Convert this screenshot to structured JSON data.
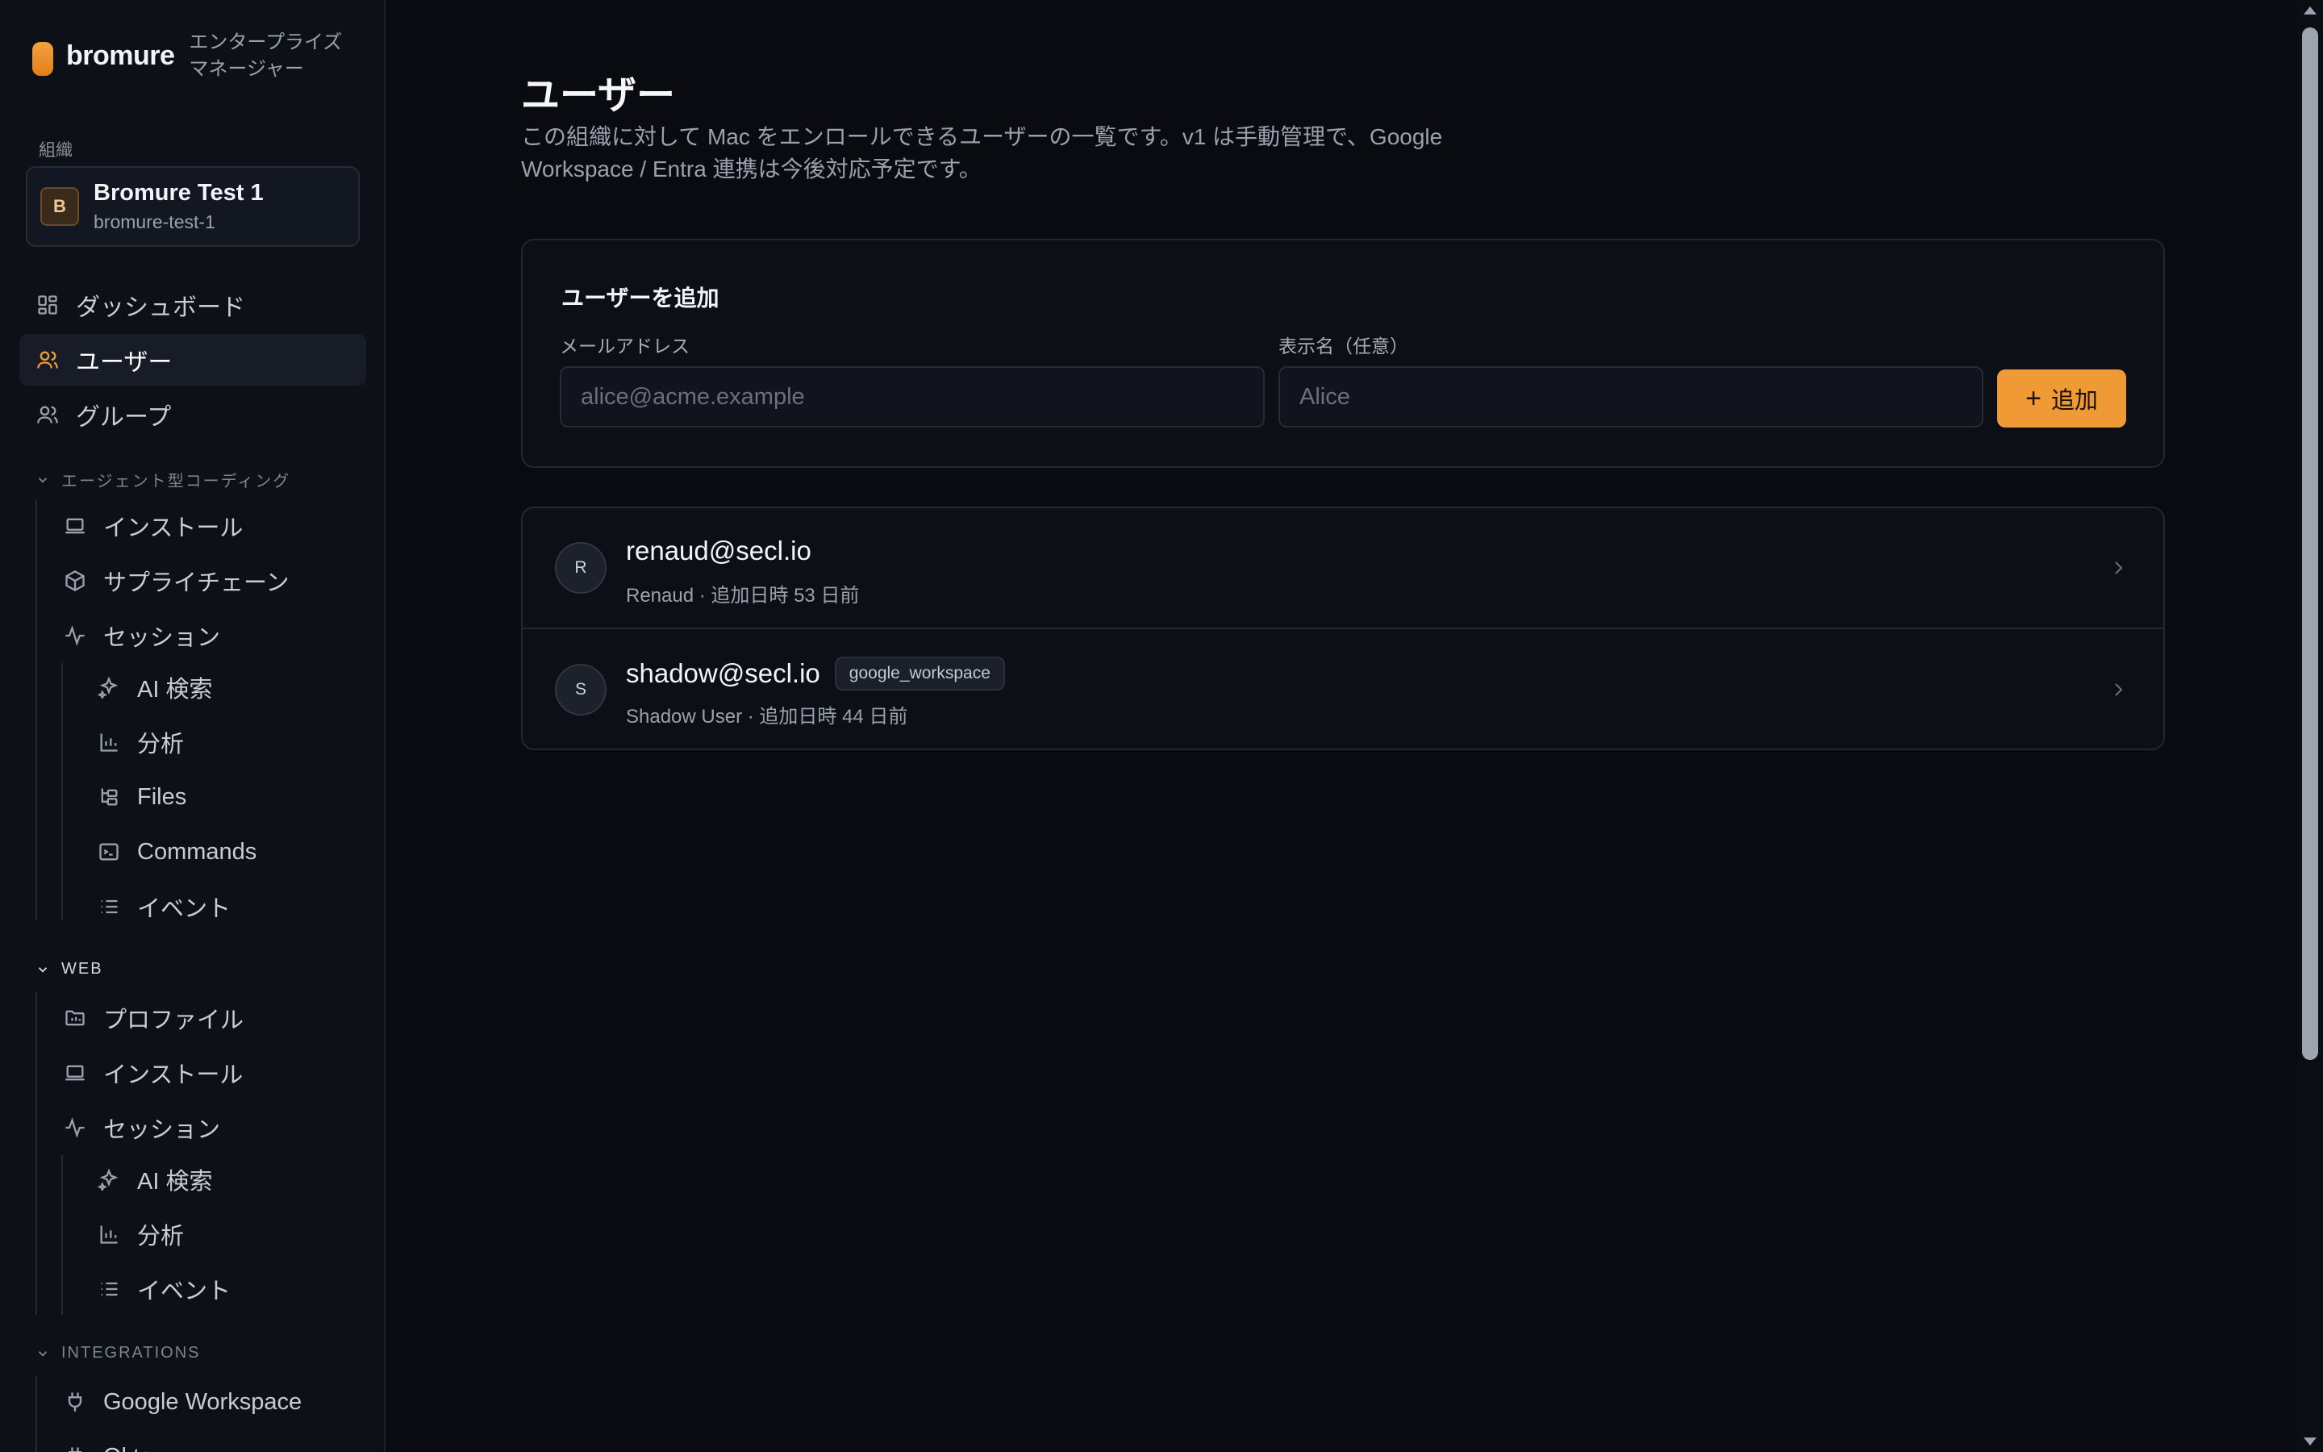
{
  "brand": {
    "name": "bromure",
    "tagline": "エンタープライズマネージャー"
  },
  "org": {
    "label": "組織",
    "avatar": "B",
    "name": "Bromure Test 1",
    "slug": "bromure-test-1"
  },
  "nav": {
    "dashboard": "ダッシュボード",
    "users": "ユーザー",
    "groups": "グループ"
  },
  "agentic": {
    "header": "エージェント型コーディング",
    "install": "インストール",
    "supply_chain": "サプライチェーン",
    "sessions": "セッション",
    "ai_search": "AI 検索",
    "analytics": "分析",
    "files": "Files",
    "commands": "Commands",
    "events": "イベント"
  },
  "web": {
    "header": "WEB",
    "profiles": "プロファイル",
    "install": "インストール",
    "sessions": "セッション",
    "ai_search": "AI 検索",
    "analytics": "分析",
    "events": "イベント"
  },
  "integrations": {
    "header": "INTEGRATIONS",
    "google_workspace": "Google Workspace",
    "next": "Okta"
  },
  "page": {
    "title": "ユーザー",
    "description": "この組織に対して Mac をエンロールできるユーザーの一覧です。v1 は手動管理で、Google Workspace / Entra 連携は今後対応予定です。"
  },
  "add_user": {
    "title": "ユーザーを追加",
    "email_label": "メールアドレス",
    "email_placeholder": "alice@acme.example",
    "name_label": "表示名（任意）",
    "name_placeholder": "Alice",
    "button_plus": "+",
    "button_label": "追加"
  },
  "users": [
    {
      "avatar": "R",
      "email": "renaud@secl.io",
      "meta": "Renaud · 追加日時 53 日前",
      "badge": ""
    },
    {
      "avatar": "S",
      "email": "shadow@secl.io",
      "meta": "Shadow User · 追加日時 44 日前",
      "badge": "google_workspace"
    }
  ],
  "colors": {
    "accent": "#ef9a35",
    "background": "#090b11",
    "sidebar": "#0d1017"
  }
}
